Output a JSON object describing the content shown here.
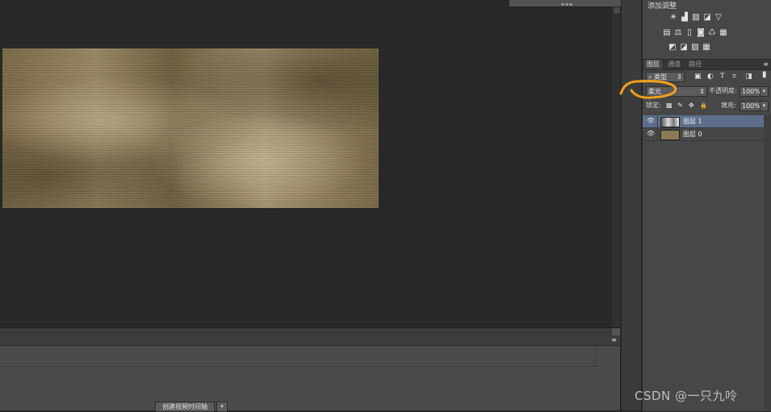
{
  "adjustments": {
    "title": "添加调整",
    "rows": [
      [
        "☀",
        "▟",
        "▨",
        "◪",
        "▽"
      ],
      [
        "▤",
        "⚖",
        "▯",
        "◙",
        "♺",
        "▦"
      ],
      [
        "◩",
        "◪",
        "▨",
        "▦"
      ]
    ]
  },
  "layers_panel": {
    "tabs": [
      "图层",
      "通道",
      "路径"
    ],
    "filter_label": "类型",
    "filter_icons": [
      "▣",
      "◐",
      "T",
      "⌗",
      "◨"
    ],
    "blend_mode": "柔光",
    "opacity_label": "不透明度:",
    "opacity_value": "100%",
    "lock_label": "锁定:",
    "lock_icons": [
      "▩",
      "✎",
      "✥",
      "🔒"
    ],
    "fill_label": "填充:",
    "fill_value": "100%",
    "layers": [
      {
        "name": "图层 1",
        "selected": true
      },
      {
        "name": "图层 0",
        "selected": false
      }
    ]
  },
  "timeline": {
    "button_label": "创建视频时间轴",
    "dropdown_glyph": "▾"
  },
  "watermark": "CSDN @一只九呤",
  "colors": {
    "selection": "#5c6e8c",
    "annotation": "#f0a020"
  }
}
